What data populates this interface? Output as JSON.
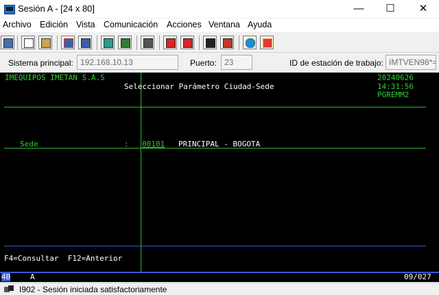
{
  "window": {
    "title": "Sesión A - [24 x 80]",
    "minimize_glyph": "—",
    "maximize_glyph": "☐",
    "close_glyph": "✕"
  },
  "menu": [
    "Archivo",
    "Edición",
    "Vista",
    "Comunicación",
    "Acciones",
    "Ventana",
    "Ayuda"
  ],
  "toolbar": {
    "icons": [
      "send-icon",
      "copy-icon",
      "paste-icon",
      "send-file-icon",
      "receive-file-icon",
      "display-icon",
      "display-alt-icon",
      "keyboard-icon",
      "record-macro-icon",
      "stop-macro-icon",
      "play-macro-icon",
      "macro-step-icon",
      "globe-icon",
      "edit-icon"
    ]
  },
  "host": {
    "system_label": "Sistema principal:",
    "system_value": "192.168.10.13",
    "port_label": "Puerto:",
    "port_value": "23",
    "workstation_label": "ID de estación de trabajo:",
    "workstation_value": "IMTVEN98*="
  },
  "screen": {
    "company": "IMEQUIPOS IMETAN S.A.S",
    "heading": "Seleccionar Parámetro Ciudad-Sede",
    "date": "20240626",
    "time": "14:31:56",
    "program": "PGREMM2",
    "field_label": "Sede",
    "field_sep": ":",
    "field_value": "00101",
    "field_desc": "PRINCIPAL - BOGOTA",
    "fkeys": "F4=Consultar  F12=Anterior"
  },
  "oia": {
    "left": "4B",
    "mode": "A",
    "cursor_pos": "09/027"
  },
  "status": {
    "message": "I902 - Sesión iniciada satisfactoriamente"
  },
  "colors": {
    "terminal_bg": "#000000",
    "field_green": "#2fd12f",
    "text_white": "#ffffff",
    "separator_blue": "#3b59d6",
    "crosshair_green": "#35b535"
  }
}
